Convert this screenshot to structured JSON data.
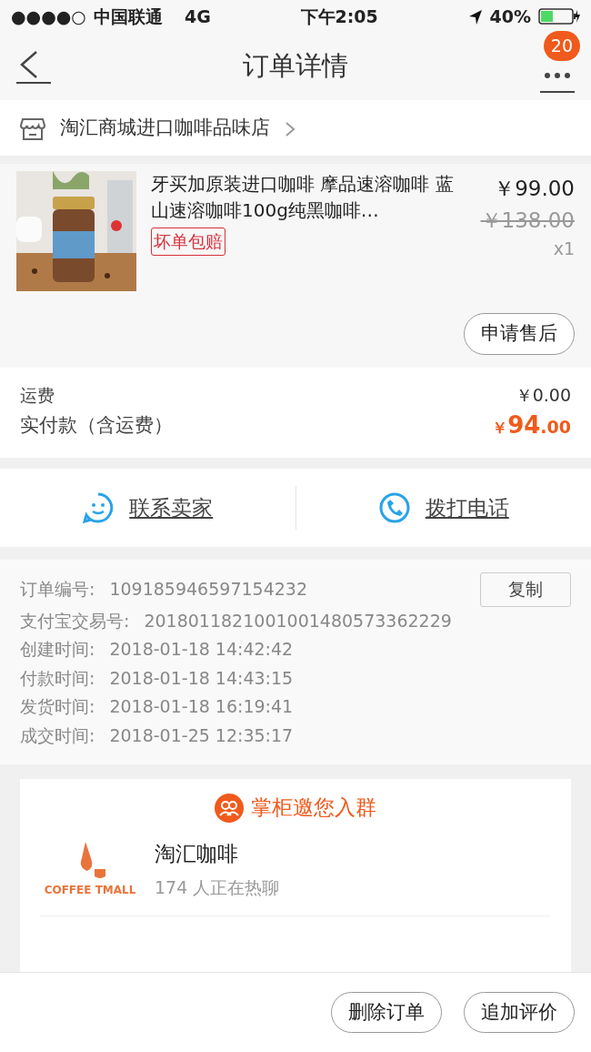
{
  "status_bar": {
    "signal_dots": "●●●●○",
    "carrier": "中国联通",
    "network": "4G",
    "time": "下午2:05",
    "battery": "40%"
  },
  "nav": {
    "title": "订单详情",
    "badge": "20"
  },
  "shop": {
    "name": "淘汇商城进口咖啡品味店"
  },
  "product": {
    "title": "牙买加原装进口咖啡 摩品速溶咖啡 蓝山速溶咖啡100g纯黑咖啡…",
    "tag": "坏单包赔",
    "price": "￥99.00",
    "original_price": "￥138.00",
    "quantity": "x1",
    "action": "申请售后"
  },
  "fees": [
    {
      "label": "运费",
      "value": "￥0.00",
      "kind": "plain"
    },
    {
      "label": "实付款（含运费）",
      "currency": "￥",
      "value": "94",
      "decimals": ".00",
      "kind": "total"
    }
  ],
  "contact": [
    {
      "label": "联系卖家",
      "kind": "chat"
    },
    {
      "label": "拨打电话",
      "kind": "phone"
    }
  ],
  "order_info": [
    {
      "label": "订单编号:",
      "value": "109185946597154232",
      "action": "复制"
    },
    {
      "label": "支付宝交易号:",
      "value": "2018011821001001480573362229"
    },
    {
      "label": "创建时间:",
      "value": "2018-01-18 14:42:42"
    },
    {
      "label": "付款时间:",
      "value": "2018-01-18 14:43:15"
    },
    {
      "label": "发货时间:",
      "value": "2018-01-18 16:19:41"
    },
    {
      "label": "成交时间:",
      "value": "2018-01-25 12:35:17"
    }
  ],
  "group_invite": {
    "title": "掌柜邀您入群",
    "logo_text": "COFFEE TMALL",
    "group_name": "淘汇咖啡",
    "members": "174 人正在热聊"
  },
  "bottom_buttons": [
    "删除订单",
    "追加评价"
  ]
}
